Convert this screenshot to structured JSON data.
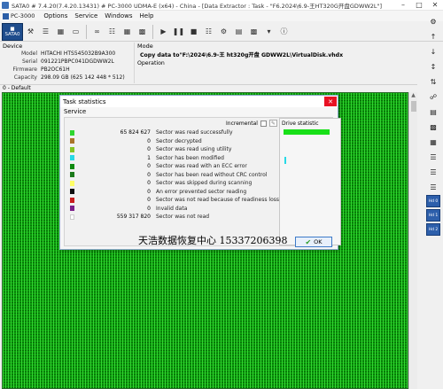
{
  "window": {
    "title": "SATA0 # 7.4.20(7.4.20.13431) # PC-3000 UDMA-E (x64) - China - [Data Extractor : Task - \"F6.2024\\6.9-王HT320G开盘GDWW2L\"]"
  },
  "menu": {
    "logo": "PC-3000",
    "items": [
      "Options",
      "Service",
      "Windows",
      "Help"
    ]
  },
  "toolbar": {
    "sata_label": "SATA0"
  },
  "device": {
    "header": "Device",
    "fields": [
      {
        "key": "Model",
        "value": "HITACHI HTS545032B9A300"
      },
      {
        "key": "Serial",
        "value": "091221PBPC041DGDWW2L"
      },
      {
        "key": "Firmware",
        "value": "PB2OC61H"
      },
      {
        "key": "Capacity",
        "value": "298.09 GB (625 142 448 * 512)"
      }
    ]
  },
  "mode": {
    "header": "Mode",
    "command": "Copy data to\"F:\\2024\\6.9-王 ht320g开盘 GDWW2L\\VirtualDisk.vhdx",
    "operation_label": "Operation"
  },
  "map": {
    "label": "0 - Default"
  },
  "dialog": {
    "title": "Task statistics",
    "section": "Service",
    "incremental_label": "Incremental",
    "drive_statistic_label": "Drive statistic",
    "ok_label": "OK",
    "rows": [
      {
        "count": "65 824 627",
        "label": "Sector was read successfully",
        "color": "#2fd62f"
      },
      {
        "count": "0",
        "label": "Sector decrypted",
        "color": "#a9742a"
      },
      {
        "count": "0",
        "label": "Sector was read using utility",
        "color": "#84c424"
      },
      {
        "count": "1",
        "label": "Sector has been modified",
        "color": "#27d9e6"
      },
      {
        "count": "0",
        "label": "Sector was read with an ECC error",
        "color": "#0f8a0f"
      },
      {
        "count": "0",
        "label": "Sector has been read without CRC control",
        "color": "#1b7a1b"
      },
      {
        "count": "0",
        "label": "Sector was skipped during scanning",
        "color": "#ffff66"
      },
      {
        "count": "0",
        "label": "An error prevented sector reading",
        "color": "#0f0f0f"
      },
      {
        "count": "0",
        "label": "Sector was not read because of readiness loss",
        "color": "#c81e1e"
      },
      {
        "count": "0",
        "label": "Invalid data",
        "color": "#7a1f8a"
      },
      {
        "count": "559 317 820",
        "label": "Sector was not read",
        "color": "#ffffff"
      }
    ]
  },
  "watermark": "天浩数据恢复中心 15337206398",
  "side_toolbar": {
    "hd_labels": [
      "Hd 0",
      "Hd 1",
      "Hd 2"
    ]
  }
}
